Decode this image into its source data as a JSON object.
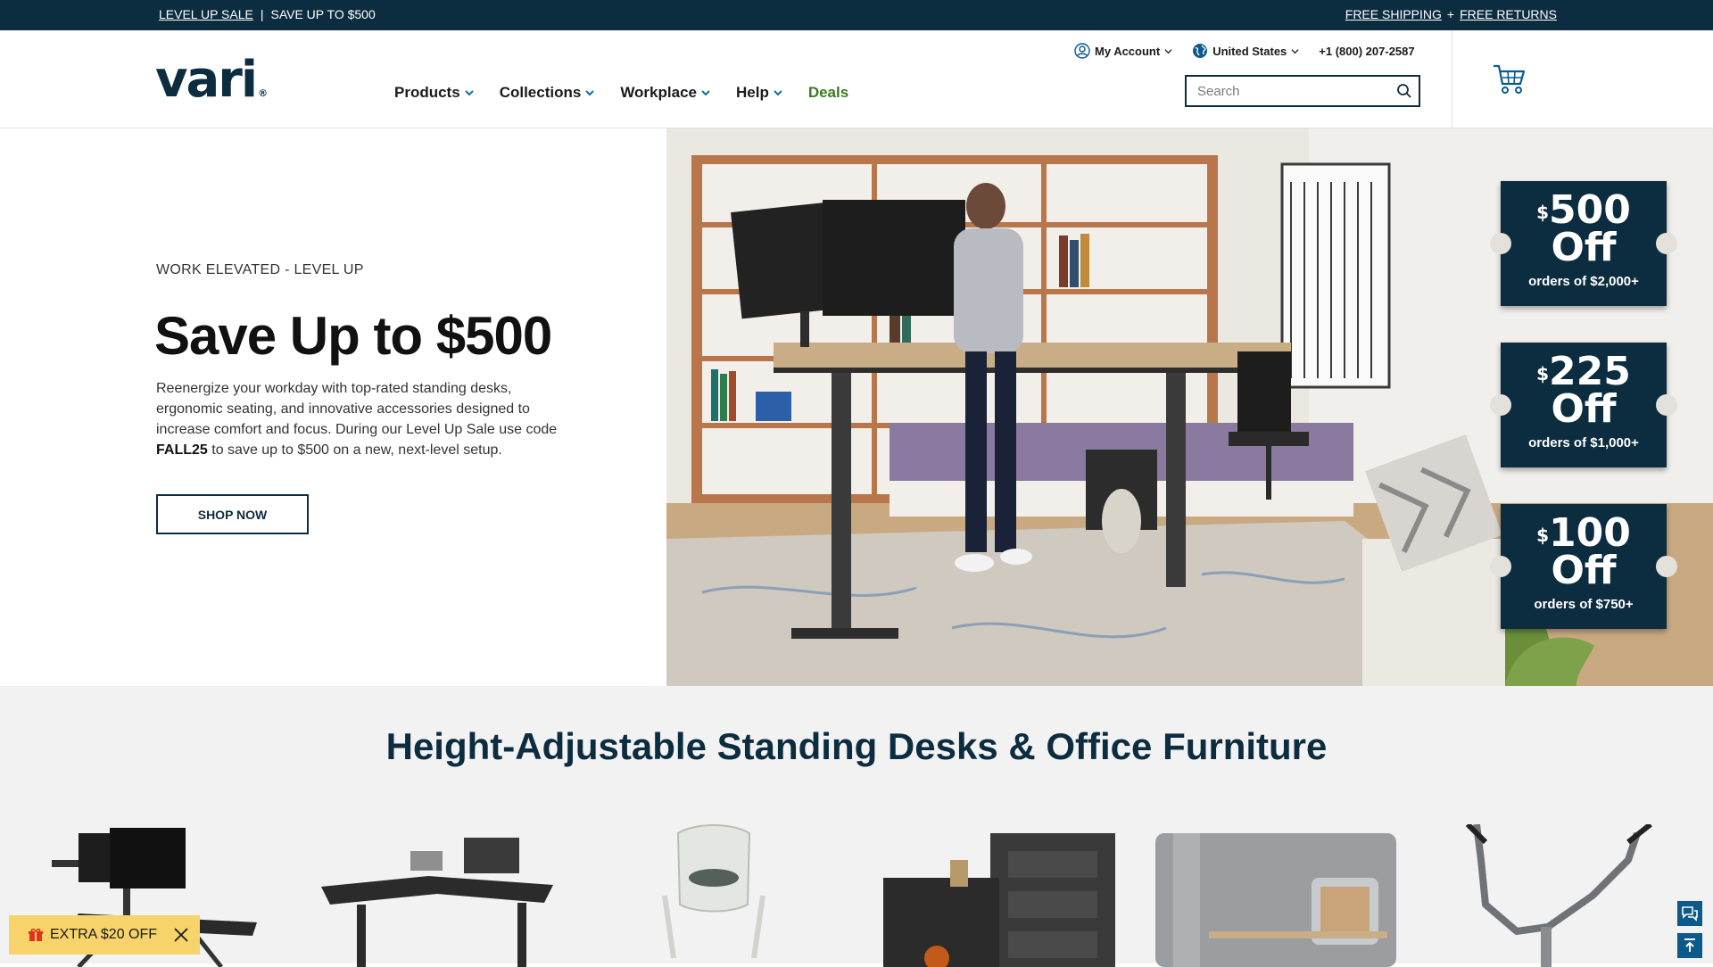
{
  "topbar": {
    "sale_link": "LEVEL UP SALE",
    "separator": "|",
    "sale_text": "SAVE UP TO $500",
    "shipping_link": "FREE SHIPPING",
    "plus": "+",
    "returns_link": "FREE RETURNS"
  },
  "header": {
    "logo": "vari",
    "logo_mark": "®",
    "account_label": "My Account",
    "region_label": "United States",
    "phone": "+1 (800) 207-2587",
    "search_placeholder": "Search"
  },
  "nav": {
    "items": [
      {
        "label": "Products"
      },
      {
        "label": "Collections"
      },
      {
        "label": "Workplace"
      },
      {
        "label": "Help"
      },
      {
        "label": "Deals"
      }
    ]
  },
  "hero": {
    "eyebrow": "WORK ELEVATED - LEVEL UP",
    "title": "Save Up to $500",
    "body_1": "Reenergize your workday with top-rated standing desks, ergonomic seating, and innovative accessories designed to increase comfort and focus. During our Level Up Sale use code",
    "code": "FALL25",
    "body_2": "to save up to $500 on a new, next-level setup.",
    "cta": "SHOP NOW"
  },
  "coupons": [
    {
      "currency": "$",
      "amount": "500",
      "off": "Off",
      "condition": "orders of $2,000+"
    },
    {
      "currency": "$",
      "amount": "225",
      "off": "Off",
      "condition": "orders of $1,000+"
    },
    {
      "currency": "$",
      "amount": "100",
      "off": "Off",
      "condition": "orders of $750+"
    }
  ],
  "section": {
    "title": "Height-Adjustable Standing Desks & Office Furniture"
  },
  "promo_badge": {
    "label": "EXTRA $20 OFF"
  },
  "colors": {
    "navy": "#0c2c40",
    "deals_green": "#3b7a22",
    "promo_yellow": "#f6d36b",
    "float_blue": "#0c5a8a"
  }
}
